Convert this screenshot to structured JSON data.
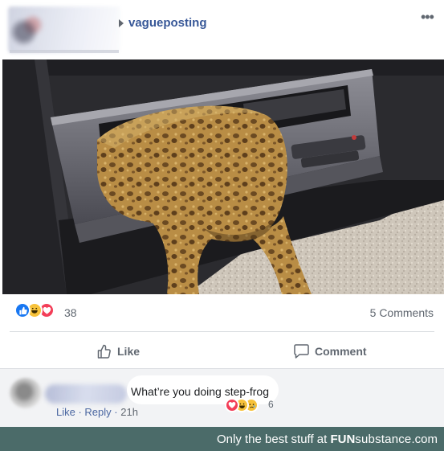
{
  "post": {
    "group_name": "vagueposting",
    "more_label": "•••"
  },
  "stats": {
    "reaction_count": "38",
    "comments_label": "5 Comments"
  },
  "actions": {
    "like_label": "Like",
    "comment_label": "Comment"
  },
  "comment": {
    "text": "What’re you doing step-frog",
    "reaction_count": "6",
    "like_label": "Like",
    "reply_label": "Reply",
    "separator": " · ",
    "time": "21h"
  },
  "footer": {
    "prefix": "Only the best stuff at ",
    "brand_bold": "FUN",
    "brand_rest": "substance",
    "brand_suffix": ".com"
  },
  "colors": {
    "link_blue": "#385898",
    "like_blue": "#1877f2",
    "love_red": "#f33e58",
    "haha_yellow": "#f7c23a",
    "footer_green": "#4b6b69"
  }
}
